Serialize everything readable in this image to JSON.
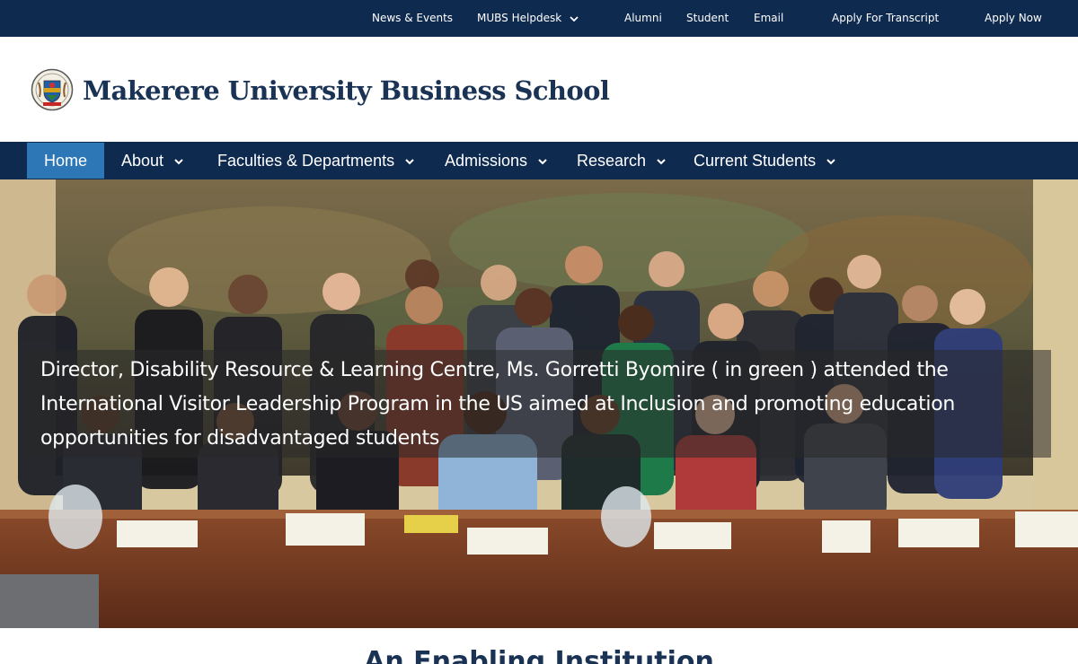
{
  "topbar": {
    "links": [
      {
        "label": "News & Events"
      },
      {
        "label": "MUBS Helpdesk",
        "icon": "chevron-down-icon"
      },
      {
        "label": "Alumni"
      },
      {
        "label": "Student"
      },
      {
        "label": "Email"
      },
      {
        "label": "Apply For Transcript"
      },
      {
        "label": "Apply Now"
      }
    ]
  },
  "header": {
    "logo_icon": "university-crest-logo",
    "title": "Makerere University Business School"
  },
  "nav": {
    "items": [
      {
        "label": "Home",
        "active": true
      },
      {
        "label": "About",
        "icon": "chevron-down-icon"
      },
      {
        "label": "Faculties & Departments",
        "icon": "chevron-down-icon"
      },
      {
        "label": "Admissions",
        "icon": "chevron-down-icon"
      },
      {
        "label": "Research",
        "icon": "chevron-down-icon"
      },
      {
        "label": "Current Students",
        "icon": "chevron-down-icon"
      }
    ]
  },
  "hero": {
    "caption": "Director, Disability Resource & Learning Centre, Ms. Gorretti Byomire ( in green ) attended the International Visitor Leadership Program in the US aimed at Inclusion and promoting education opportunities for disadvantaged students"
  },
  "section": {
    "title": "An Enabling Institution"
  },
  "colors": {
    "navy": "#0f2a4f",
    "active_nav": "#2d77b7",
    "title_text": "#1a3355"
  }
}
